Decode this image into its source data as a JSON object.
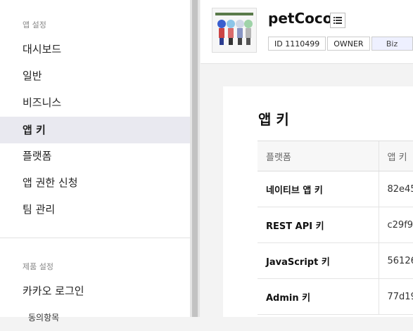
{
  "sidebar": {
    "section1_title": "앱 설정",
    "items": [
      {
        "label": "대시보드"
      },
      {
        "label": "일반"
      },
      {
        "label": "비즈니스"
      },
      {
        "label": "앱 키"
      },
      {
        "label": "플랫폼"
      },
      {
        "label": "앱 권한 신청"
      },
      {
        "label": "팀 관리"
      }
    ],
    "section2_title": "제품 설정",
    "items2": [
      {
        "label": "카카오 로그인"
      },
      {
        "label": "동의항목"
      }
    ]
  },
  "header": {
    "app_name": "petCoco",
    "badges": {
      "id": "ID 1110499",
      "role": "OWNER",
      "type": "Biz"
    }
  },
  "card": {
    "title": "앱 키",
    "columns": {
      "platform": "플랫폼",
      "key": "앱 키"
    },
    "rows": [
      {
        "platform": "네이티브 앱 키",
        "key": "82e45"
      },
      {
        "platform": "REST API 키",
        "key": "c29f9"
      },
      {
        "platform": "JavaScript 키",
        "key": "56126"
      },
      {
        "platform": "Admin 키",
        "key": "77d19"
      }
    ]
  },
  "colors": {
    "active_bg": "#e9e9f0",
    "biz_badge_bg": "#eef0ff"
  }
}
